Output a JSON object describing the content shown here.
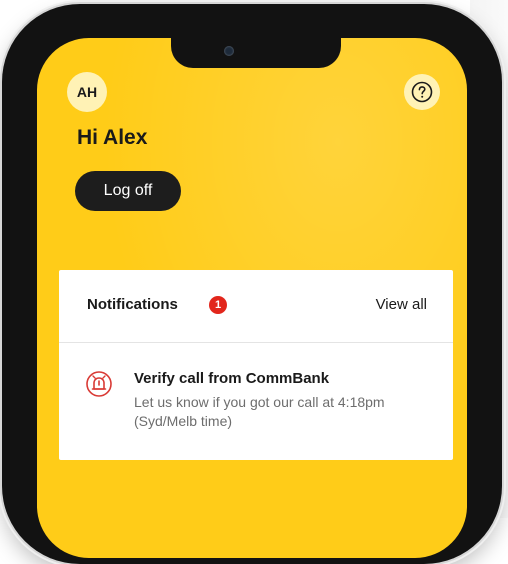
{
  "header": {
    "avatar_initials": "AH",
    "help_icon": "question-mark-circle-icon",
    "greeting": "Hi Alex",
    "logoff_label": "Log off"
  },
  "notifications": {
    "title": "Notifications",
    "badge_count": "1",
    "view_all_label": "View all",
    "items": [
      {
        "icon": "alarm-bell-icon",
        "title": "Verify call from CommBank",
        "body": "Let us know if you got our call at 4:18pm (Syd/Melb time)"
      }
    ]
  },
  "colors": {
    "screen_background": "#ffcc18",
    "avatar_background": "#fff2b5",
    "button_dark": "#1d1d1d",
    "badge_red": "#e2261c",
    "alert_icon_red": "#d93a35"
  }
}
